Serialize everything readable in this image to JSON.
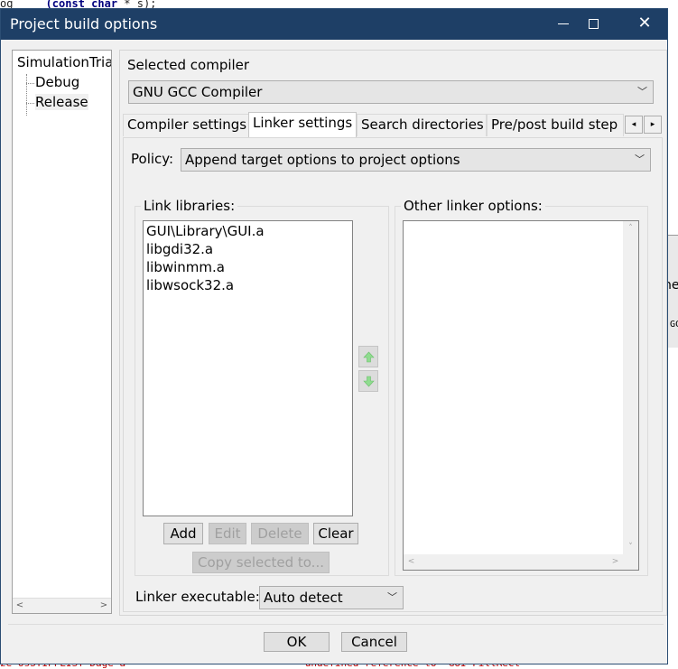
{
  "background": {
    "top_code": {
      "prefix": "og",
      "keyword": "(const char",
      "suffix": " * s);"
    },
    "bottom_code": "ze osSTIPFLIST Dage a                              undefined reference to 'GUI FillRect'",
    "right_text1": "ne",
    "right_text2": "GC"
  },
  "window": {
    "title": "Project build options",
    "controls": {
      "minimize": "minimize",
      "maximize": "maximize",
      "close": "✕"
    }
  },
  "tree": {
    "root": "SimulationTrial",
    "children": [
      "Debug",
      "Release"
    ],
    "selected": "Release",
    "scroll_left": "<",
    "scroll_right": ">"
  },
  "compiler": {
    "label": "Selected compiler",
    "value": "GNU GCC Compiler"
  },
  "tabs": {
    "items": [
      "Compiler settings",
      "Linker settings",
      "Search directories",
      "Pre/post build step"
    ],
    "active": "Linker settings",
    "scroll_left": "◂",
    "scroll_right": "▸"
  },
  "policy": {
    "label": "Policy:",
    "value": "Append target options to project options"
  },
  "link_libraries": {
    "title": "Link libraries:",
    "items": [
      "GUI\\Library\\GUI.a",
      "libgdi32.a",
      "libwinmm.a",
      "libwsock32.a"
    ],
    "buttons": {
      "add": "Add",
      "edit": "Edit",
      "delete": "Delete",
      "clear": "Clear",
      "copy": "Copy selected to..."
    }
  },
  "other_options": {
    "title": "Other linker options:",
    "value": "",
    "scroll_up": "˄",
    "scroll_down": "˅",
    "scroll_left": "<",
    "scroll_right": ">"
  },
  "linker_executable": {
    "label": "Linker executable:",
    "value": "Auto detect"
  },
  "footer": {
    "ok": "OK",
    "cancel": "Cancel"
  },
  "colors": {
    "titlebar": "#1e3f66",
    "arrow_green": "#7fd07f"
  }
}
